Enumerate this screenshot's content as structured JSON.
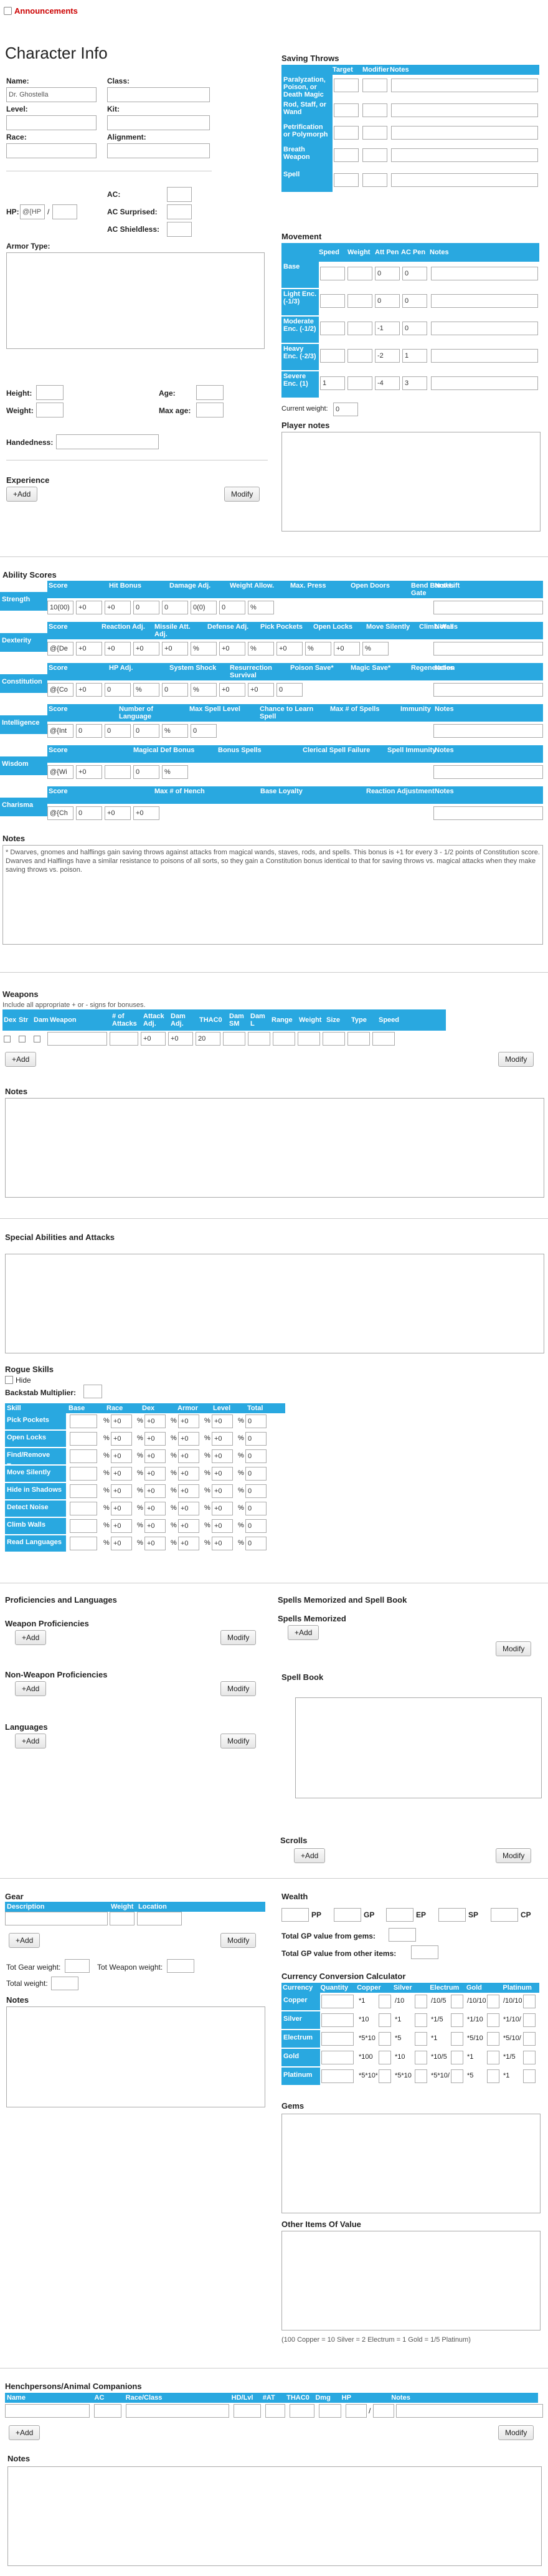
{
  "announcements": "Announcements",
  "title": "Character Info",
  "char": {
    "name_label": "Name:",
    "name_value": "Dr. Ghostella",
    "class_label": "Class:",
    "level_label": "Level:",
    "kit_label": "Kit:",
    "race_label": "Race:",
    "alignment_label": "Alignment:",
    "hp_label": "HP:",
    "hp_value": "@{HP",
    "hp_sep": "/",
    "ac_label": "AC:",
    "ac_surprised_label": "AC Surprised:",
    "ac_shieldless_label": "AC Shieldless:",
    "armor_type_label": "Armor Type:",
    "height_label": "Height:",
    "weight_label": "Weight:",
    "age_label": "Age:",
    "max_age_label": "Max age:",
    "handedness_label": "Handedness:"
  },
  "experience": {
    "title": "Experience",
    "add": "+Add",
    "modify": "Modify"
  },
  "saving_throws": {
    "title": "Saving Throws",
    "headers": [
      "",
      "Target",
      "Modifier",
      "Notes"
    ],
    "rows": [
      "Paralyzation, Poison, or Death Magic",
      "Rod, Staff, or Wand",
      "Petrification or Polymorph",
      "Breath Weapon",
      "Spell"
    ]
  },
  "movement": {
    "title": "Movement",
    "headers": [
      "",
      "Speed",
      "Weight",
      "Att Pen",
      "AC Pen",
      "Notes"
    ],
    "rows": [
      {
        "label": "Base",
        "att": "0",
        "ac": "0"
      },
      {
        "label": "Light Enc. (-1/3)",
        "att": "0",
        "ac": "0"
      },
      {
        "label": "Moderate Enc. (-1/2)",
        "att": "-1",
        "ac": "0"
      },
      {
        "label": "Heavy Enc. (-2/3)",
        "att": "-2",
        "ac": "1"
      },
      {
        "label": "Severe Enc. (1)",
        "speed": "1",
        "att": "-4",
        "ac": "3"
      }
    ],
    "current_weight_label": "Current weight:",
    "current_weight": "0"
  },
  "player_notes_label": "Player notes",
  "ability_scores": {
    "title": "Ability Scores",
    "strength": {
      "label": "Strength",
      "headers": [
        "Score",
        "Hit Bonus",
        "Damage Adj.",
        "Weight Allow.",
        "Max. Press",
        "Open Doors",
        "Bend Bars/ Lift Gate",
        "Notes"
      ],
      "values": [
        "10(00)",
        "+0",
        "+0",
        "0",
        "0",
        "0(0)",
        "0",
        "%"
      ]
    },
    "dexterity": {
      "label": "Dexterity",
      "headers": [
        "Score",
        "Reaction Adj.",
        "Missile Att. Adj.",
        "Defense Adj.",
        "Pick Pockets",
        "Open Locks",
        "Move Silently",
        "Climb Walls",
        "Notes"
      ],
      "values": [
        "@{De",
        "+0",
        "+0",
        "+0",
        "+0",
        "%",
        "+0",
        "%",
        "+0",
        "%",
        "+0",
        "%"
      ]
    },
    "constitution": {
      "label": "Constitution",
      "headers": [
        "Score",
        "HP Adj.",
        "System Shock",
        "Resurrection Survival",
        "Poison Save*",
        "Magic Save*",
        "Regeneration",
        "Notes"
      ],
      "values": [
        "@{Co",
        "+0",
        "0",
        "%",
        "0",
        "%",
        "+0",
        "+0",
        "0"
      ]
    },
    "intelligence": {
      "label": "Intelligence",
      "headers": [
        "Score",
        "Number of Language",
        "Max Spell Level",
        "Chance to Learn Spell",
        "Max # of Spells",
        "Immunity",
        "Notes"
      ],
      "values": [
        "@{Int",
        "0",
        "0",
        "0",
        "%",
        "0"
      ]
    },
    "wisdom": {
      "label": "Wisdom",
      "headers": [
        "Score",
        "Magical Def Bonus",
        "Bonus Spells",
        "Clerical Spell Failure",
        "Spell Immunity",
        "Notes"
      ],
      "values": [
        "@{Wi",
        "+0",
        "",
        "0",
        "%"
      ]
    },
    "charisma": {
      "label": "Charisma",
      "headers": [
        "Score",
        "Max # of Hench",
        "Base Loyalty",
        "Reaction Adjustment",
        "Notes"
      ],
      "values": [
        "@{Ch",
        "0",
        "+0",
        "+0"
      ]
    }
  },
  "notes_label": "Notes",
  "ability_note": "* Dwarves, gnomes and halflings gain saving throws against attacks from magical wands, staves, rods, and spells. This bonus is +1 for every 3 - 1/2 points of Constitution score. Dwarves and Halflings have a similar resistance to poisons of all sorts, so they gain a Constitution bonus identical to that for saving throws vs. magical attacks when they make saving throws vs. poison.",
  "weapons": {
    "title": "Weapons",
    "hint": "Include all appropriate + or - signs for bonuses.",
    "headers": [
      "Dex",
      "Str",
      "Dam",
      "Weapon",
      "# of Attacks",
      "Attack Adj.",
      "Dam Adj.",
      "THAC0",
      "Dam SM",
      "Dam L",
      "Range",
      "Weight",
      "Size",
      "Type",
      "Speed"
    ],
    "row": [
      "+0",
      "+0",
      "20"
    ],
    "add": "+Add",
    "modify": "Modify"
  },
  "special": {
    "title": "Special Abilities and Attacks"
  },
  "rogue": {
    "title": "Rogue Skills",
    "hide": "Hide",
    "backstab": "Backstab Multiplier:",
    "headers": [
      "Skill",
      "Base",
      "Race",
      "Dex",
      "Armor",
      "Level",
      "Total"
    ],
    "skills": [
      "Pick Pockets",
      "Open Locks",
      "Find/Remove Traps",
      "Move Silently",
      "Hide in Shadows",
      "Detect Noise",
      "Climb Walls",
      "Read Languages"
    ],
    "pct": "%",
    "plus0": "+0",
    "zero": "0"
  },
  "prof": {
    "title": "Proficiencies and Languages",
    "weapon": "Weapon Proficiencies",
    "nonweapon": "Non-Weapon Proficiencies",
    "languages": "Languages",
    "add": "+Add",
    "modify": "Modify"
  },
  "spells": {
    "title": "Spells Memorized and Spell Book",
    "memorized": "Spells Memorized",
    "book": "Spell Book",
    "scrolls": "Scrolls",
    "add": "+Add",
    "modify": "Modify"
  },
  "gear": {
    "title": "Gear",
    "headers": [
      "Description",
      "Weight",
      "Location"
    ],
    "add": "+Add",
    "modify": "Modify",
    "tot_gear": "Tot Gear weight:",
    "tot_weapon": "Tot Weapon weight:",
    "total": "Total weight:",
    "notes": "Notes"
  },
  "wealth": {
    "title": "Wealth",
    "coins": [
      "PP",
      "GP",
      "EP",
      "SP",
      "CP"
    ],
    "gems_total": "Total GP value from gems:",
    "other_total": "Total GP value from other items:"
  },
  "currency": {
    "title": "Currency Conversion Calculator",
    "headers": [
      "Currency",
      "Quantity",
      "Copper",
      "Silver",
      "Electrum",
      "Gold",
      "Platinum"
    ],
    "rows": [
      {
        "name": "Copper",
        "vals": [
          "*1",
          "/10",
          "/10/5",
          "/10/10",
          "/10/10"
        ]
      },
      {
        "name": "Silver",
        "vals": [
          "*10",
          "*1",
          "*1/5",
          "*1/10",
          "*1/10/"
        ]
      },
      {
        "name": "Electrum",
        "vals": [
          "*5*10",
          "*5",
          "*1",
          "*5/10",
          "*5/10/"
        ]
      },
      {
        "name": "Gold",
        "vals": [
          "*100",
          "*10",
          "*10/5",
          "*1",
          "*1/5"
        ]
      },
      {
        "name": "Platinum",
        "vals": [
          "*5*10*",
          "*5*10",
          "*5*10/",
          "*5",
          "*1"
        ]
      }
    ],
    "footnote": "(100 Copper = 10 Silver = 2 Electrum = 1 Gold = 1/5 Platinum)"
  },
  "gems_label": "Gems",
  "other_items_label": "Other Items Of Value",
  "hench": {
    "title": "Henchpersons/Animal Companions",
    "headers": [
      "Name",
      "AC",
      "Race/Class",
      "HD/Lvl",
      "#AT",
      "THAC0",
      "Dmg",
      "HP",
      "Notes"
    ],
    "hp_sep": "/",
    "add": "+Add",
    "modify": "Modify"
  },
  "final_notes_label": "Notes"
}
